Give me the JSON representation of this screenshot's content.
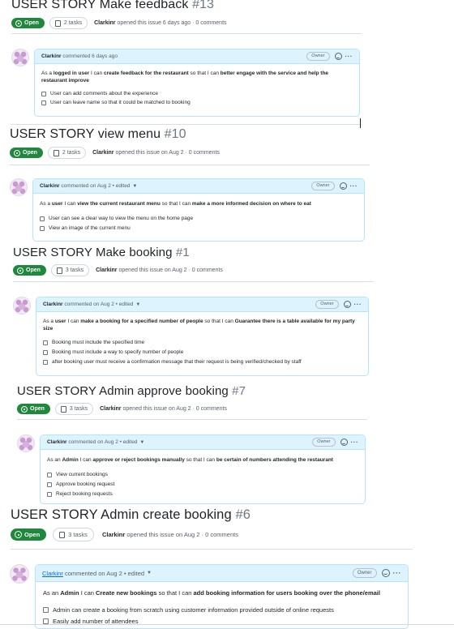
{
  "issues": [
    {
      "title": "USER STORY Make feedback",
      "number": "#13",
      "state": "Open",
      "tasks": "2 tasks",
      "author": "Clarkinr",
      "opened": "opened this issue 6 days ago · 0 comments",
      "comment": {
        "author": "Clarkinr",
        "meta": "commented 6 days ago",
        "role": "Owner",
        "body": {
          "t1": "As a ",
          "b1": "logged in user",
          "t2": " I can ",
          "b2": "create feedback for the restaurant",
          "t3": " so that I can ",
          "b3": "better engage with the service and help the restaurant improve"
        },
        "tasks": [
          "User can add comments about the experience",
          "User can leave name so that it could be matched to booking"
        ]
      }
    },
    {
      "title": "USER STORY view menu",
      "number": "#10",
      "state": "Open",
      "tasks": "2 tasks",
      "author": "Clarkinr",
      "opened": "opened this issue on Aug 2 · 0 comments",
      "comment": {
        "author": "Clarkinr",
        "meta": "commented on Aug 2 • edited",
        "role": "Owner",
        "body": {
          "t1": "As a ",
          "b1": "user",
          "t2": " I can ",
          "b2": "view the current restaurant menu",
          "t3": " so that I can ",
          "b3": "make a more informed decision on where to eat"
        },
        "tasks": [
          "User can see a clear way to view the menu on the home page",
          "View an image of the current menu"
        ]
      }
    },
    {
      "title": "USER STORY Make booking",
      "number": "#1",
      "state": "Open",
      "tasks": "3 tasks",
      "author": "Clarkinr",
      "opened": "opened this issue on Aug 2 · 0 comments",
      "comment": {
        "author": "Clarkinr",
        "meta": "commented on Aug 2 • edited",
        "role": "Owner",
        "body": {
          "t1": "As a ",
          "b1": "user",
          "t2": " I can ",
          "b2": "make a booking for a specified number of people",
          "t3": " so that I can ",
          "b3": "Guarantee there is a table available for my party size"
        },
        "tasks": [
          "Booking must include the specified time",
          "Booking must include a way to specify number of people",
          "after booking user must receive a confirmation message that their request is being verified/checked by staff"
        ]
      }
    },
    {
      "title": "USER STORY Admin approve booking",
      "number": "#7",
      "state": "Open",
      "tasks": "3 tasks",
      "author": "Clarkinr",
      "opened": "opened this issue on Aug 2 · 0 comments",
      "comment": {
        "author": "Clarkinr",
        "meta": "commented on Aug 2 • edited",
        "role": "Owner",
        "body": {
          "t1": "As an ",
          "b1": "Admin",
          "t2": " I can ",
          "b2": "approve or reject bookings manually",
          "t3": " so that I can ",
          "b3": "be certain of numbers attending the restaurant"
        },
        "tasks": [
          "View current bookings",
          "Approve booking request",
          "Reject booking requests"
        ]
      }
    },
    {
      "title": "USER STORY Admin create booking",
      "number": "#6",
      "state": "Open",
      "tasks": "3 tasks",
      "author": "Clarkinr",
      "opened": "opened this issue on Aug 2 · 0 comments",
      "comment": {
        "author": "Clarkinr",
        "meta": "commented on Aug 2 • edited",
        "role": "Owner",
        "body": {
          "t1": "As an ",
          "b1": "Admin",
          "t2": " I can ",
          "b2": "Create new bookings",
          "t3": " so that I can ",
          "b3": "add booking information for users booking over the phone/email"
        },
        "tasks": [
          "Admin can create a booking from scratch using customer information provided outside of online requests",
          "Easily add number of attendees"
        ]
      }
    }
  ]
}
